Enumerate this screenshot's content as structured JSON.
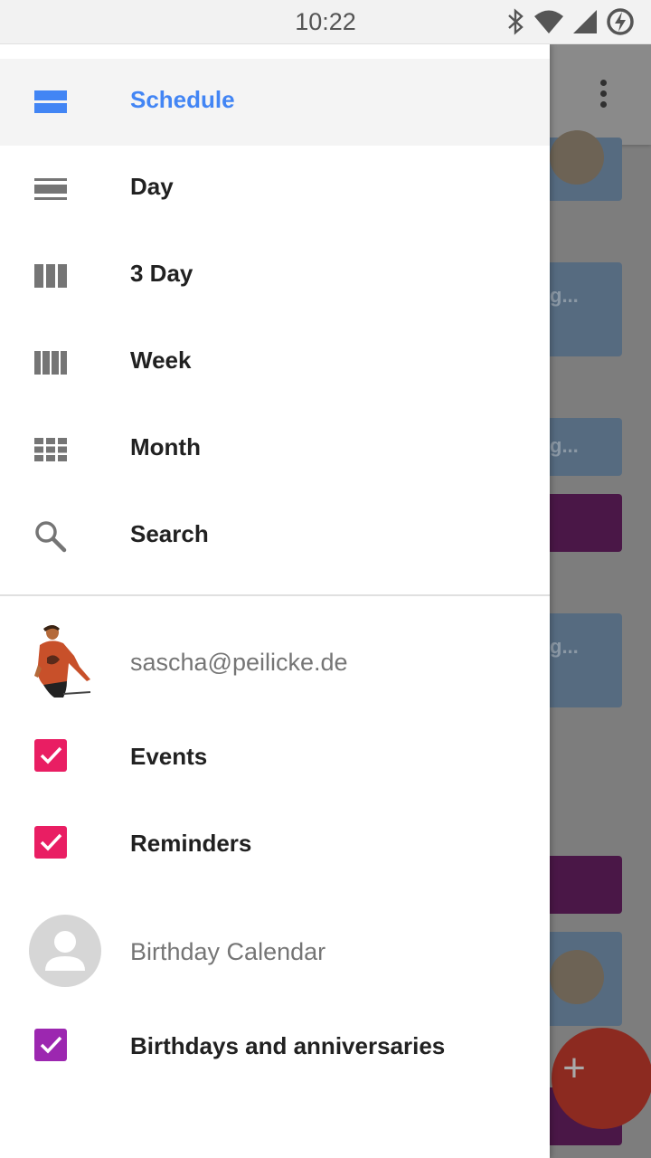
{
  "status_bar": {
    "time": "10:22",
    "icons": [
      "bluetooth-icon",
      "wifi-icon",
      "cell-signal-icon",
      "battery-charging-icon"
    ]
  },
  "drawer": {
    "nav_items": [
      {
        "label": "Schedule",
        "icon": "schedule-view-icon",
        "active": true
      },
      {
        "label": "Day",
        "icon": "day-view-icon",
        "active": false
      },
      {
        "label": "3 Day",
        "icon": "three-day-view-icon",
        "active": false
      },
      {
        "label": "Week",
        "icon": "week-view-icon",
        "active": false
      },
      {
        "label": "Month",
        "icon": "month-view-icon",
        "active": false
      },
      {
        "label": "Search",
        "icon": "search-icon",
        "active": false
      }
    ],
    "account": {
      "email": "sascha@peilicke.de"
    },
    "calendars": [
      {
        "label": "Events",
        "checked": true,
        "color": "#e91e63"
      },
      {
        "label": "Reminders",
        "checked": true,
        "color": "#e91e63"
      }
    ],
    "birthday_account": {
      "label": "Birthday Calendar"
    },
    "birthday_calendars": [
      {
        "label": "Birthdays and anniversaries",
        "checked": true,
        "color": "#9c27b0"
      }
    ]
  },
  "background": {
    "fab_label": "+",
    "card_snippet": "g..."
  },
  "colors": {
    "accent": "#4285f4",
    "events": "#e91e63",
    "birthdays": "#9c27b0",
    "fab": "#db4437"
  }
}
